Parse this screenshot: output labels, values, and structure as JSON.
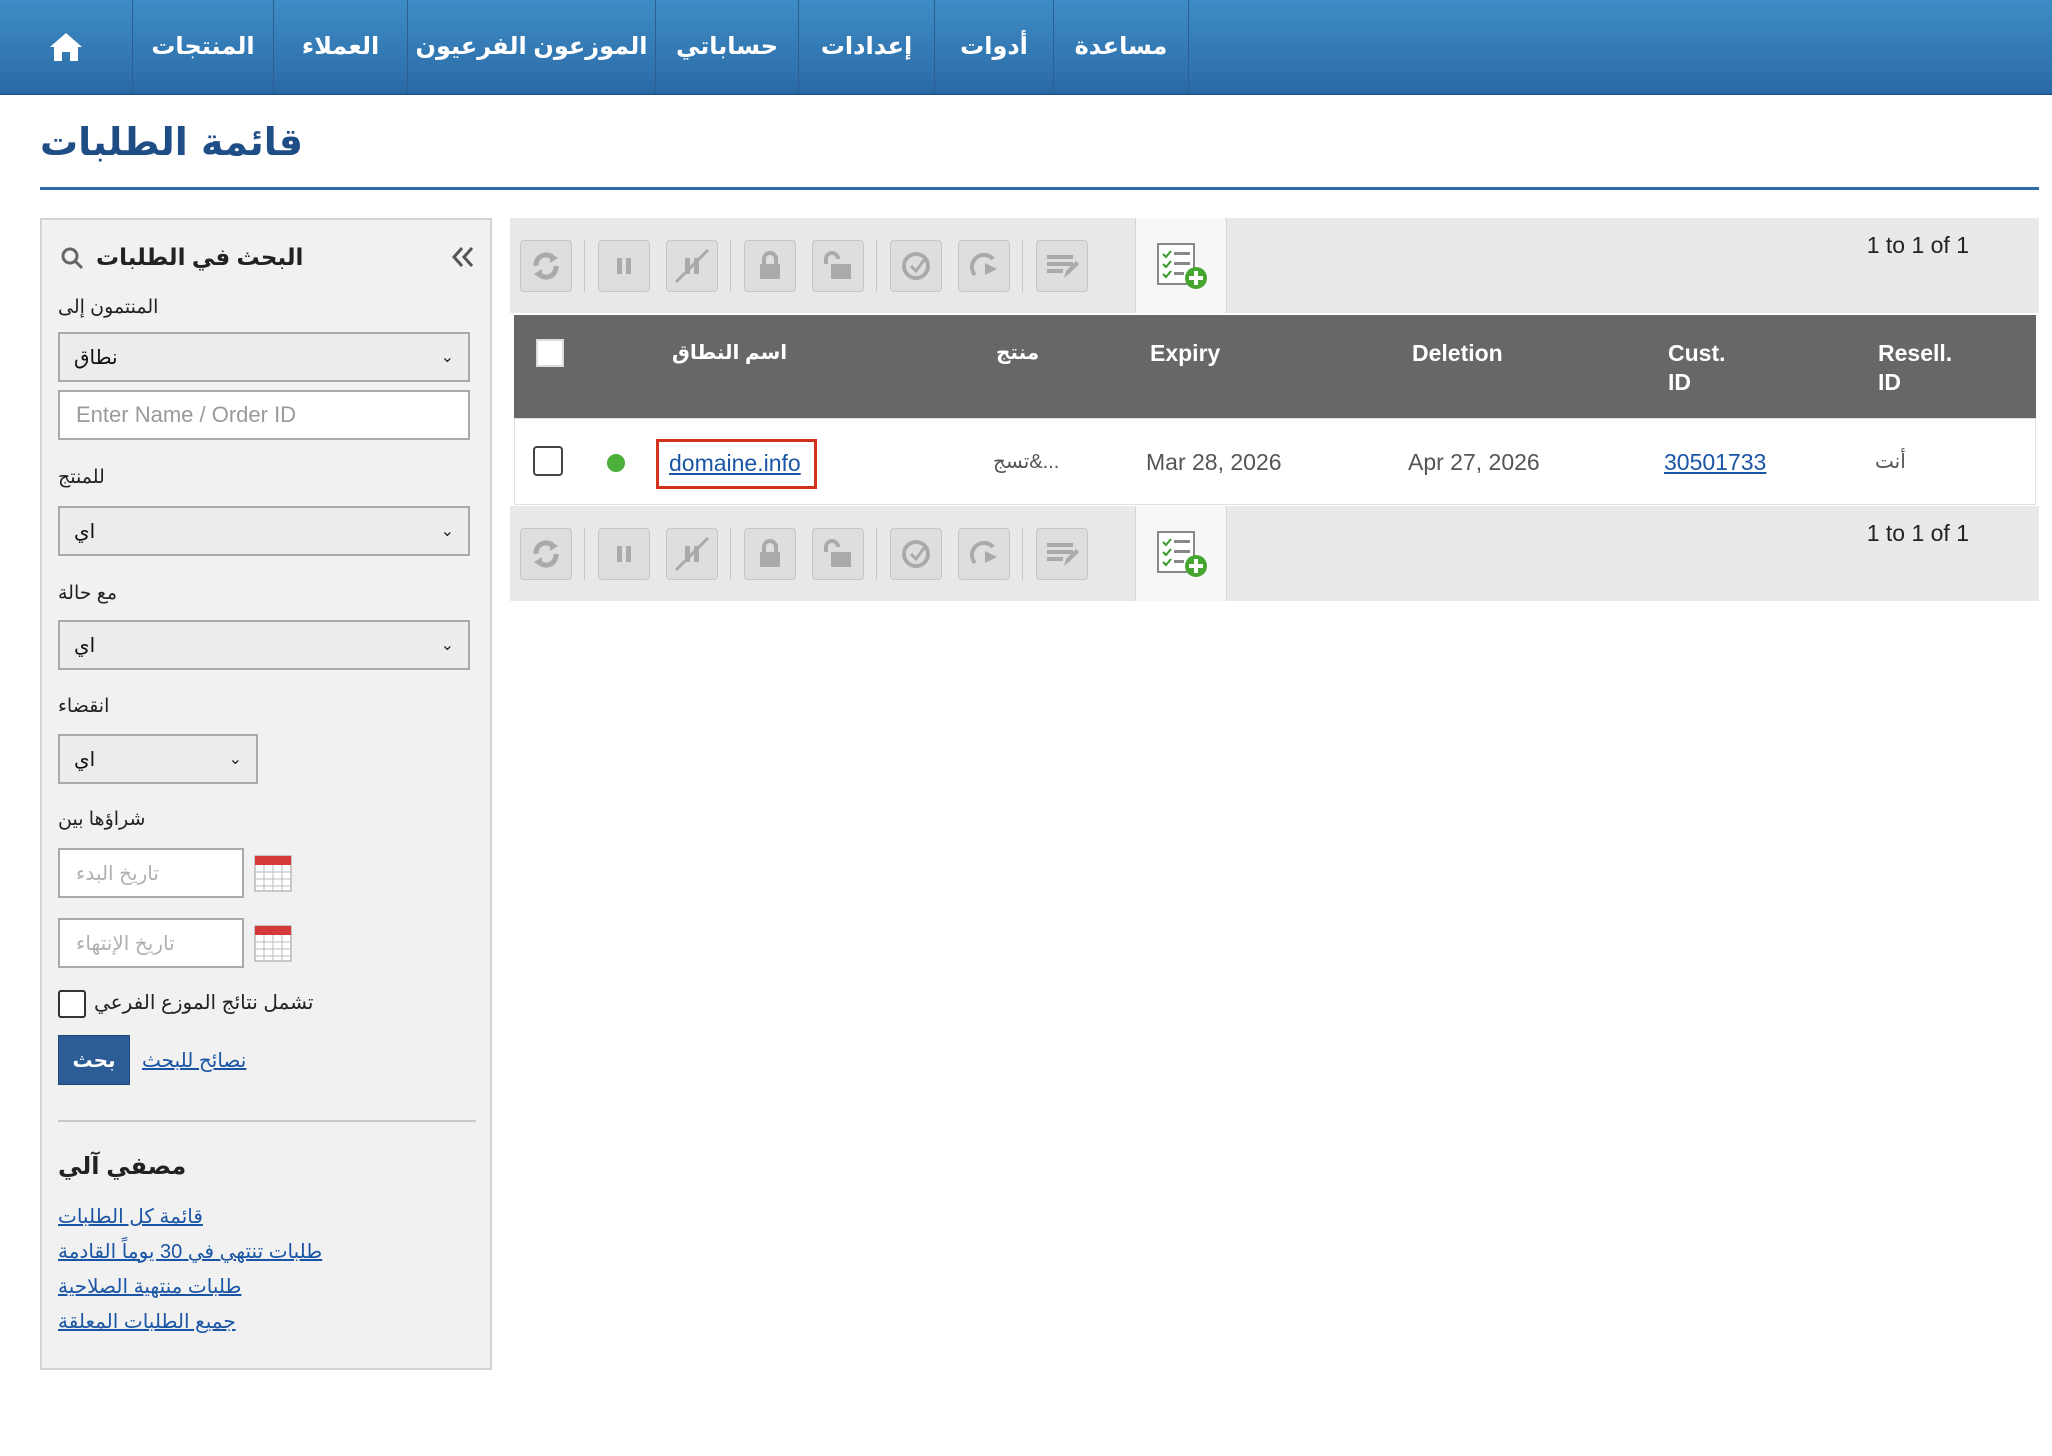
{
  "nav": {
    "items": [
      "مساعدة",
      "أدوات",
      "إعدادات",
      "حساباتي",
      "الموزعون الفرعيون",
      "العملاء",
      "المنتجات"
    ]
  },
  "page": {
    "title": "قائمة الطلبات"
  },
  "search": {
    "title": "البحث في الطلبات",
    "belongs_to_label": "المنتمون إلى",
    "belongs_to_value": "نطاق",
    "name_placeholder": "Enter Name / Order ID",
    "product_label": "للمنتج",
    "product_value": "اي",
    "status_label": "مع حالة",
    "status_value": "اي",
    "expiry_label": "انقضاء",
    "expiry_value": "اي",
    "purchased_label": "شراؤها بين",
    "start_placeholder": "تاريخ البدء",
    "end_placeholder": "تاريخ الإنتهاء",
    "include_subreseller_label": "تشمل نتائج الموزع الفرعي",
    "search_button": "بحث",
    "tips_link": "نصائح للبحث"
  },
  "auto_filter": {
    "title": "مصفي آلي",
    "links": [
      "قائمة كل الطلبات",
      "طلبات تنتهي في 30 يوماً القادمة",
      "طلبات منتهية الصلاحية",
      "جميع الطلبات المعلقة"
    ]
  },
  "toolbar": {
    "pager": "1 to 1 of 1",
    "icons": [
      "renew-icon",
      "suspend-icon",
      "unsuspend-icon",
      "lock-icon",
      "unlock-icon",
      "transfer-in-icon",
      "transfer-out-icon",
      "bulk-edit-icon"
    ],
    "add_icon": "add-order-icon"
  },
  "table": {
    "headers": {
      "domain": "اسم النطاق",
      "product": "منتج",
      "expiry": "Expiry",
      "deletion": "Deletion",
      "cust_id": [
        "Cust.",
        "ID"
      ],
      "resell_id": [
        "Resell.",
        "ID"
      ]
    },
    "rows": [
      {
        "status_color": "#4caf3a",
        "domain": "domaine.info",
        "product": "تسج&...",
        "expiry": "Mar 28, 2026",
        "deletion": "Apr 27, 2026",
        "cust_id": "30501733",
        "resell_id": "أنت"
      }
    ]
  }
}
